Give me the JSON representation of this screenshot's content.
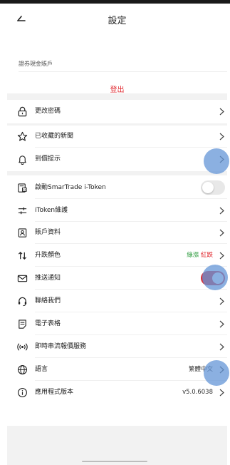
{
  "header": {
    "title": "設定"
  },
  "account": {
    "label": "證券現金賬戶",
    "logout": "登出"
  },
  "rows": {
    "change_password": "更改密碼",
    "saved_news": "已收藏的新聞",
    "price_alert": "到價提示",
    "itoken_activate": "啟動SmarTrade i-Token",
    "itoken_maintain": "iToken維護",
    "account_info": "賬戶資料",
    "updown_color": "升跌顏色",
    "updown_green": "綠漲",
    "updown_red": "紅跌",
    "push": "推送通知",
    "contact": "聯絡我們",
    "forms": "電子表格",
    "stream": "即時串流報價服務",
    "language": "語言",
    "language_value": "繁體中文",
    "version": "應用程式版本",
    "version_value": "v5.0.6038"
  },
  "toggles": {
    "itoken_activate": false,
    "push": true
  },
  "colors": {
    "accent_red": "#e0262c",
    "green": "#2b9a3c",
    "touch_indicator": "#6496d7"
  }
}
